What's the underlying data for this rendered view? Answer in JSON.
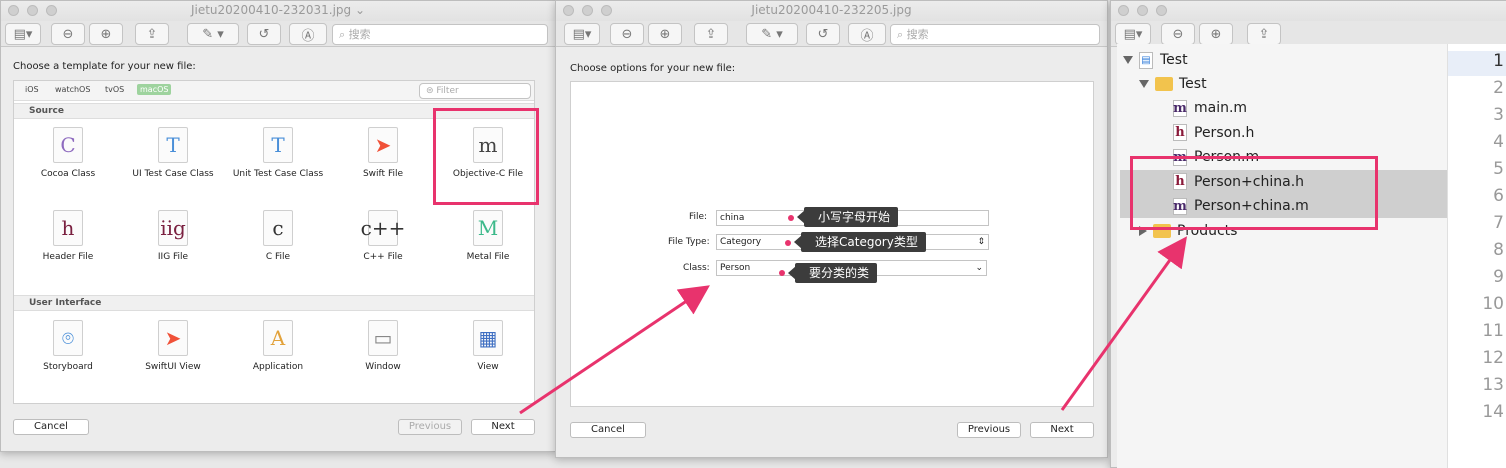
{
  "window1": {
    "title": "Jietu20200410-232031.jpg ⌄",
    "search": "搜索"
  },
  "window2": {
    "title": "Jietu20200410-232205.jpg",
    "search": "搜索"
  },
  "template": {
    "prompt": "Choose a template for your new file:",
    "tabs": [
      "iOS",
      "watchOS",
      "tvOS",
      "macOS"
    ],
    "filter": "Filter",
    "source_label": "Source",
    "ui_label": "User Interface",
    "source_items": [
      {
        "label": "Cocoa Class",
        "glyph": "C",
        "color": "#8e6bbf"
      },
      {
        "label": "UI Test Case Class",
        "glyph": "T",
        "color": "#4a8fd8"
      },
      {
        "label": "Unit Test Case Class",
        "glyph": "T",
        "color": "#4a8fd8"
      },
      {
        "label": "Swift File",
        "glyph": "➤",
        "color": "#f05138"
      },
      {
        "label": "Objective-C File",
        "glyph": "m",
        "color": "#444"
      },
      {
        "label": "Header File",
        "glyph": "h",
        "color": "#7a2040"
      },
      {
        "label": "IIG File",
        "glyph": "iig",
        "color": "#7a2040"
      },
      {
        "label": "C File",
        "glyph": "c",
        "color": "#333"
      },
      {
        "label": "C++ File",
        "glyph": "c++",
        "color": "#333"
      },
      {
        "label": "Metal File",
        "glyph": "M",
        "color": "#3cb98a"
      }
    ],
    "ui_items": [
      {
        "label": "Storyboard",
        "glyph": "⌾",
        "color": "#4a8fd8"
      },
      {
        "label": "SwiftUI View",
        "glyph": "➤",
        "color": "#f05138"
      },
      {
        "label": "Application",
        "glyph": "A",
        "color": "#e2a23b"
      },
      {
        "label": "Window",
        "glyph": "▭",
        "color": "#888"
      },
      {
        "label": "View",
        "glyph": "▦",
        "color": "#3f6fc2"
      }
    ],
    "cancel": "Cancel",
    "previous": "Previous",
    "next": "Next"
  },
  "options": {
    "prompt": "Choose options for your new file:",
    "file_label": "File:",
    "file_value": "china",
    "type_label": "File Type:",
    "type_value": "Category",
    "class_label": "Class:",
    "class_value": "Person",
    "callout_file": "小写字母开始",
    "callout_type": "选择Category类型",
    "callout_class": "要分类的类",
    "cancel": "Cancel",
    "previous": "Previous",
    "next": "Next"
  },
  "navigator": {
    "project": "Test",
    "group": "Test",
    "files": [
      {
        "name": "main.m",
        "kind": "m"
      },
      {
        "name": "Person.h",
        "kind": "h"
      },
      {
        "name": "Person.m",
        "kind": "m"
      },
      {
        "name": "Person+china.h",
        "kind": "h"
      },
      {
        "name": "Person+china.m",
        "kind": "m"
      }
    ],
    "products": "Products",
    "line_numbers": [
      "1",
      "2",
      "3",
      "4",
      "5",
      "6",
      "7",
      "8",
      "9",
      "10",
      "11",
      "12",
      "13",
      "14"
    ]
  },
  "colors": {
    "highlight": "#e8336d"
  }
}
